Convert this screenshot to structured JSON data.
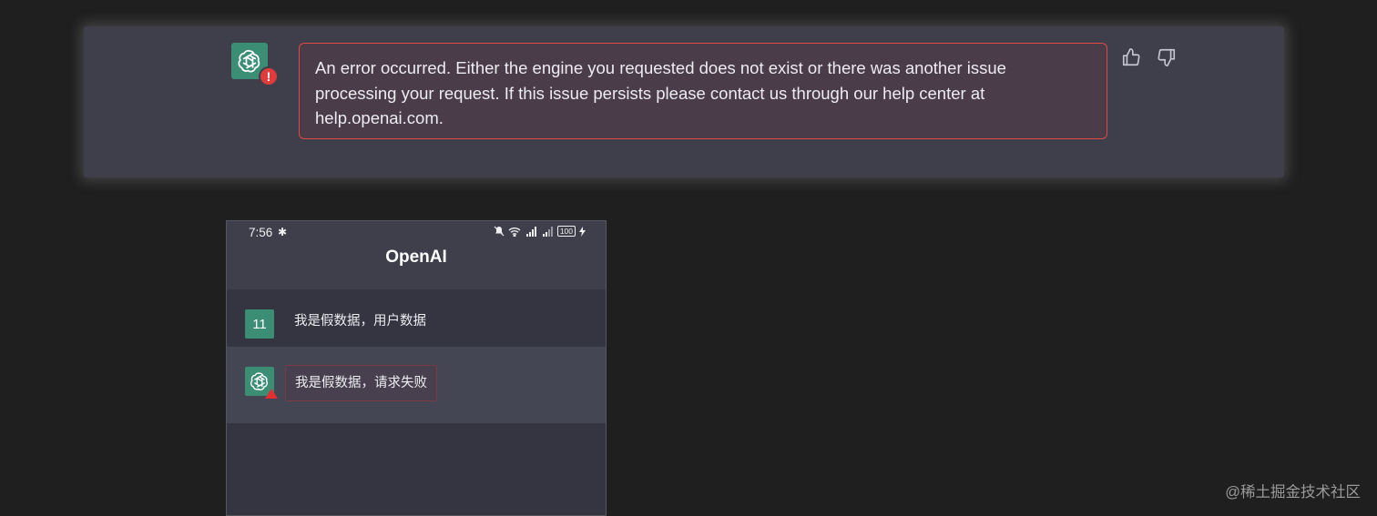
{
  "web_chat": {
    "error_message": "An error occurred. Either the engine you requested does not exist or there was another issue processing your request. If this issue persists please contact us through our help center at help.openai.com.",
    "error_badge": "!",
    "avatar_icon": "openai-logo-icon",
    "actions": [
      {
        "icon": "thumbs-up-icon"
      },
      {
        "icon": "thumbs-down-icon"
      }
    ],
    "colors": {
      "card_bg": "#3e3f4b",
      "error_border": "#e04848",
      "avatar_bg": "#3b8e74"
    }
  },
  "phone": {
    "status": {
      "time": "7:56",
      "bluetooth_icon": "bluetooth-icon",
      "right_icons": [
        "mute-bell-icon",
        "wifi-icon",
        "signal-icon",
        "signal-icon",
        "battery-icon",
        "charging-icon"
      ],
      "battery": "100"
    },
    "title": "OpenAI",
    "user_message": {
      "avatar_text": "11",
      "text": "我是假数据，用户数据"
    },
    "bot_message": {
      "text": "我是假数据，请求失败",
      "avatar_icon": "openai-logo-icon",
      "warning_icon": "warning-triangle-icon"
    }
  },
  "watermark": "@稀土掘金技术社区"
}
